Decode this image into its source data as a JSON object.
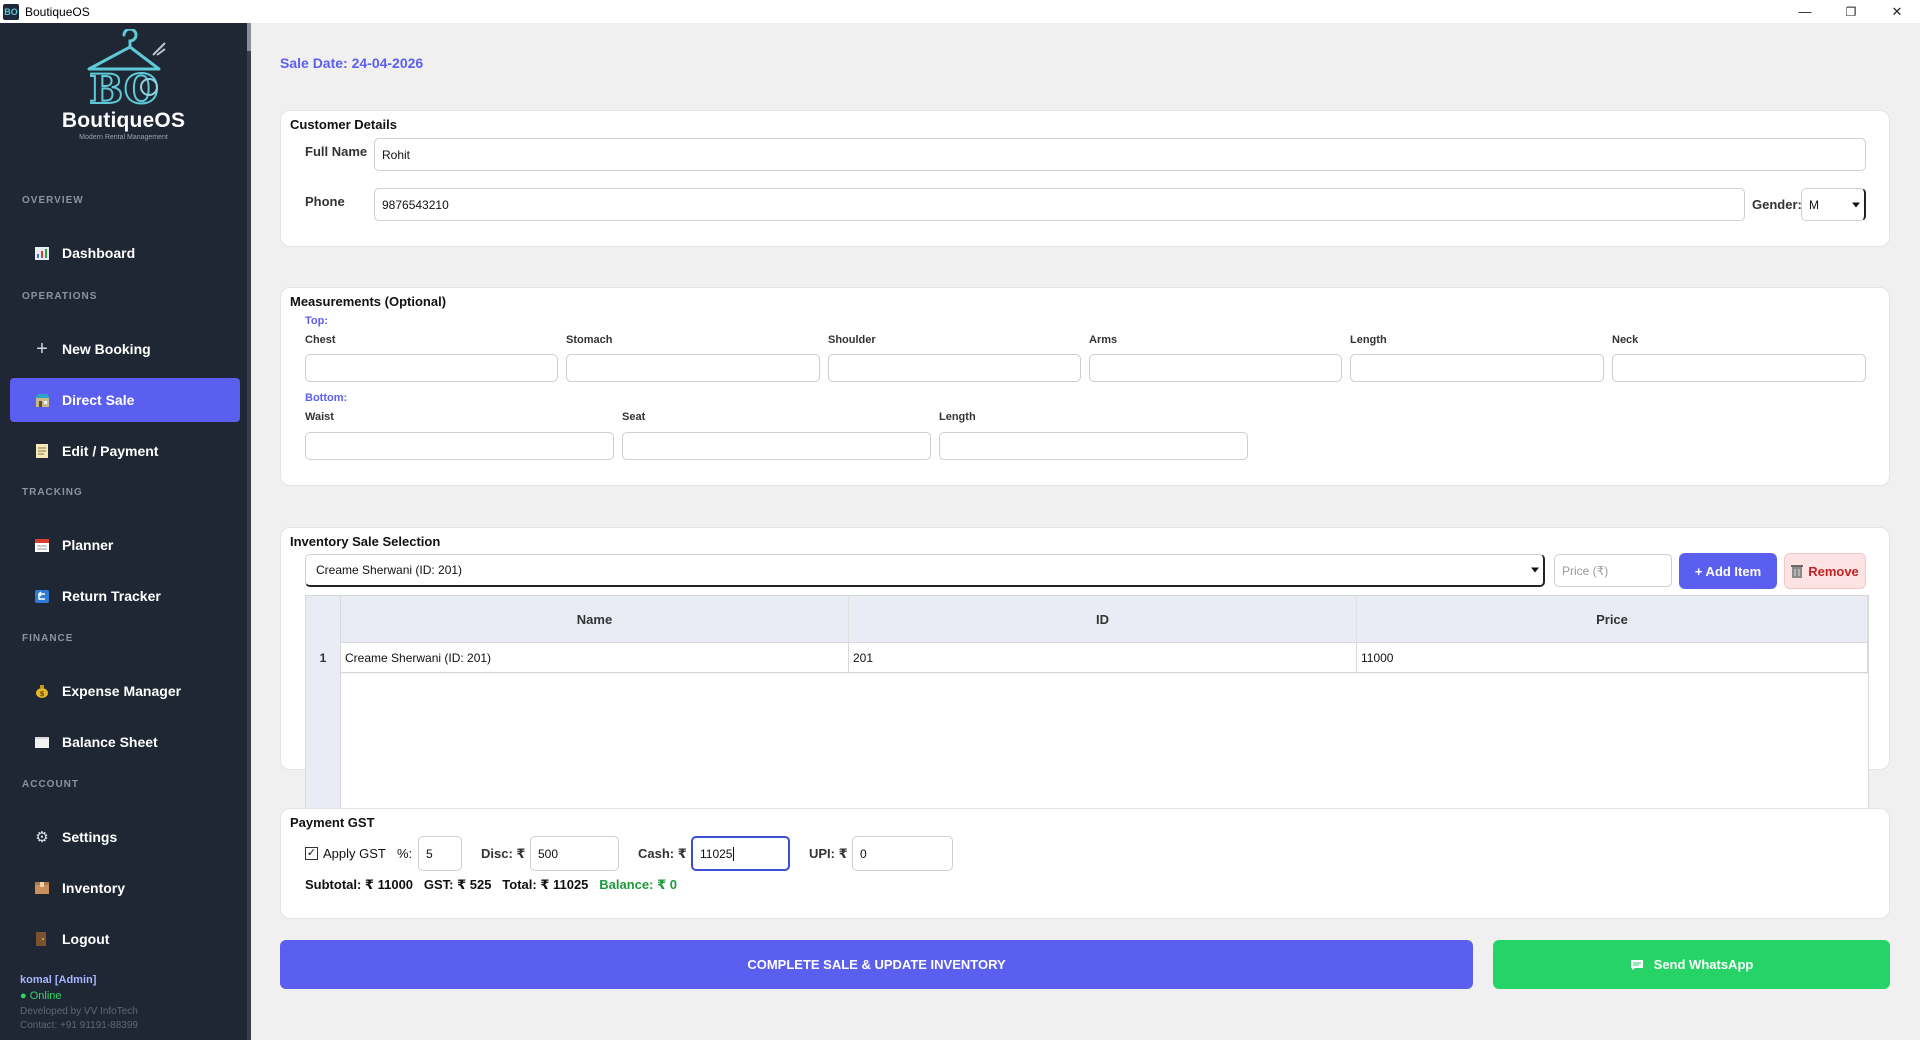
{
  "window": {
    "title": "BoutiqueOS",
    "icon_text": "BO",
    "minimize_glyph": "—",
    "maximize_glyph": "❐",
    "close_glyph": "✕"
  },
  "sidebar": {
    "logo": {
      "text": "BoutiqueOS",
      "tagline": "Modern Rental Management"
    },
    "sections": {
      "overview": "OVERVIEW",
      "operations": "OPERATIONS",
      "tracking": "TRACKING",
      "finance": "FINANCE",
      "account": "ACCOUNT"
    },
    "items": {
      "dashboard": {
        "label": "Dashboard",
        "icon": "chart-icon"
      },
      "new_booking": {
        "label": "New Booking",
        "icon": "plus-icon"
      },
      "direct_sale": {
        "label": "Direct Sale",
        "icon": "store-icon",
        "active": true
      },
      "edit_payment": {
        "label": "Edit / Payment",
        "icon": "memo-icon"
      },
      "planner": {
        "label": "Planner",
        "icon": "calendar-icon"
      },
      "return_tracker": {
        "label": "Return Tracker",
        "icon": "return-icon"
      },
      "expense_manager": {
        "label": "Expense Manager",
        "icon": "money-bag-icon"
      },
      "balance_sheet": {
        "label": "Balance Sheet",
        "icon": "sheet-icon"
      },
      "settings": {
        "label": "Settings",
        "icon": "gear-icon"
      },
      "inventory": {
        "label": "Inventory",
        "icon": "box-icon"
      },
      "logout": {
        "label": "Logout",
        "icon": "logout-icon"
      }
    },
    "user": {
      "name": "komal  [Admin]",
      "status": "● Online",
      "developer": "Developed by VV InfoTech",
      "contact": "Contact: +91 91191-88399"
    }
  },
  "main": {
    "sale_date": "Sale Date: 24-04-2026",
    "customer": {
      "title": "Customer Details",
      "full_name_label": "Full Name",
      "full_name_value": "Rohit",
      "phone_label": "Phone",
      "phone_value": "9876543210",
      "gender_label": "Gender:",
      "gender_value": "M"
    },
    "measurements": {
      "title": "Measurements (Optional)",
      "top_label": "Top:",
      "top_fields": [
        "Chest",
        "Stomach",
        "Shoulder",
        "Arms",
        "Length",
        "Neck"
      ],
      "bottom_label": "Bottom:",
      "bottom_fields": [
        "Waist",
        "Seat",
        "Length"
      ]
    },
    "inventory": {
      "title": "Inventory Sale Selection",
      "selected_item": "Creame Sherwani (ID: 201)",
      "price_placeholder": "Price (₹)",
      "add_label": "+ Add Item",
      "remove_label": "Remove",
      "columns": [
        "Name",
        "ID",
        "Price"
      ],
      "rows": [
        {
          "num": "1",
          "name": "Creame Sherwani (ID: 201)",
          "id": "201",
          "price": "11000"
        }
      ]
    },
    "payment": {
      "title": "Payment  GST",
      "apply_gst_label": "Apply GST",
      "apply_gst_checked": true,
      "pct_label": "%:",
      "pct_value": "5",
      "disc_label": "Disc: ₹",
      "disc_value": "500",
      "cash_label": "Cash: ₹",
      "cash_value": "11025",
      "upi_label": "UPI: ₹",
      "upi_value": "0",
      "subtotal": "Subtotal: ₹ 11000",
      "gst": "GST: ₹ 525",
      "total": "Total: ₹ 11025",
      "balance": "Balance: ₹ 0"
    },
    "actions": {
      "complete_label": "COMPLETE SALE & UPDATE INVENTORY",
      "whatsapp_label": "Send WhatsApp"
    }
  },
  "colors": {
    "accent": "#5b5ff0",
    "sidebar_bg": "#1e2733",
    "whatsapp": "#25d366",
    "balance": "#1d9b3a",
    "remove": "#c42323"
  }
}
